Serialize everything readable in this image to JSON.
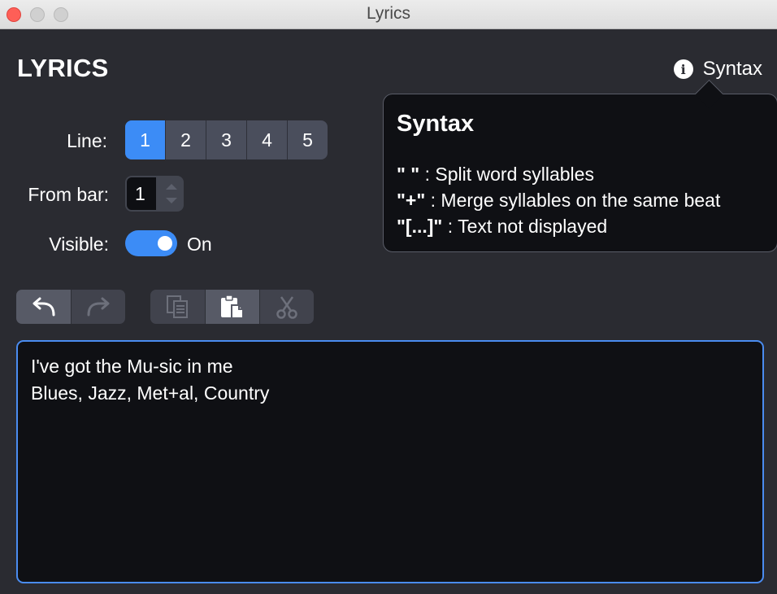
{
  "window": {
    "title": "Lyrics"
  },
  "header": {
    "title": "LYRICS",
    "syntax_label": "Syntax",
    "info_icon": "info-icon"
  },
  "form": {
    "line_label": "Line:",
    "lines": [
      "1",
      "2",
      "3",
      "4",
      "5"
    ],
    "active_line": "1",
    "from_bar_label": "From bar:",
    "from_bar_value": "1",
    "visible_label": "Visible:",
    "visible_state": "On"
  },
  "toolbar": {
    "history": [
      {
        "name": "undo-icon",
        "enabled": true
      },
      {
        "name": "redo-icon",
        "enabled": false
      }
    ],
    "clipboard": [
      {
        "name": "copy-icon",
        "enabled": false
      },
      {
        "name": "paste-icon",
        "enabled": true
      },
      {
        "name": "cut-icon",
        "enabled": false
      }
    ]
  },
  "editor": {
    "lines": [
      "I've got the Mu-sic in me",
      "Blues, Jazz, Met+al, Country"
    ]
  },
  "popover": {
    "title": "Syntax",
    "rules": [
      {
        "key": "\" \"",
        "text": " : Split word syllables"
      },
      {
        "key": "\"+\"",
        "text": " : Merge syllables on the same beat"
      },
      {
        "key": "\"[...]\"",
        "text": " : Text not displayed"
      }
    ]
  },
  "colors": {
    "accent": "#3c8cf6",
    "background": "#2a2b31",
    "editor_bg": "#0f1014",
    "close": "#fe5f57"
  }
}
